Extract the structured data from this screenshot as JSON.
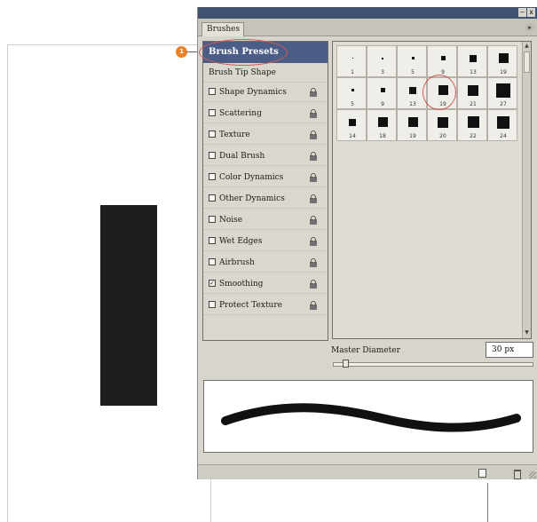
{
  "window": {
    "title": "",
    "tab_label": "Brushes",
    "close_label": "x",
    "minimize_label": "–",
    "tab_menu_glyph": "▸"
  },
  "callout": {
    "number": "1",
    "color": "#e8832a"
  },
  "options_list": {
    "selected": "Brush Presets",
    "header_item": "Brush Tip Shape",
    "items": [
      {
        "label": "Shape Dynamics",
        "checked": false
      },
      {
        "label": "Scattering",
        "checked": false
      },
      {
        "label": "Texture",
        "checked": false
      },
      {
        "label": "Dual Brush",
        "checked": false
      },
      {
        "label": "Color Dynamics",
        "checked": false
      },
      {
        "label": "Other Dynamics",
        "checked": false
      },
      {
        "label": "Noise",
        "checked": false
      },
      {
        "label": "Wet Edges",
        "checked": false
      },
      {
        "label": "Airbrush",
        "checked": false
      },
      {
        "label": "Smoothing",
        "checked": true
      },
      {
        "label": "Protect Texture",
        "checked": false
      }
    ],
    "check_glyph": "✓"
  },
  "brush_grid": {
    "presets": [
      {
        "size": "1"
      },
      {
        "size": "3"
      },
      {
        "size": "5"
      },
      {
        "size": "9"
      },
      {
        "size": "13"
      },
      {
        "size": "19"
      },
      {
        "size": "5"
      },
      {
        "size": "9"
      },
      {
        "size": "13"
      },
      {
        "size": "19"
      },
      {
        "size": "21"
      },
      {
        "size": "27"
      },
      {
        "size": "14"
      },
      {
        "size": "18"
      },
      {
        "size": "19"
      },
      {
        "size": "20"
      },
      {
        "size": "22"
      },
      {
        "size": "24"
      }
    ],
    "selected_index": 9
  },
  "master_diameter": {
    "label": "Master Diameter",
    "value": "30 px",
    "slider_level": 0.05
  },
  "colors": {
    "titlebar": "#405272",
    "selected_row": "#4b5d86",
    "highlight": "#d65b58"
  }
}
